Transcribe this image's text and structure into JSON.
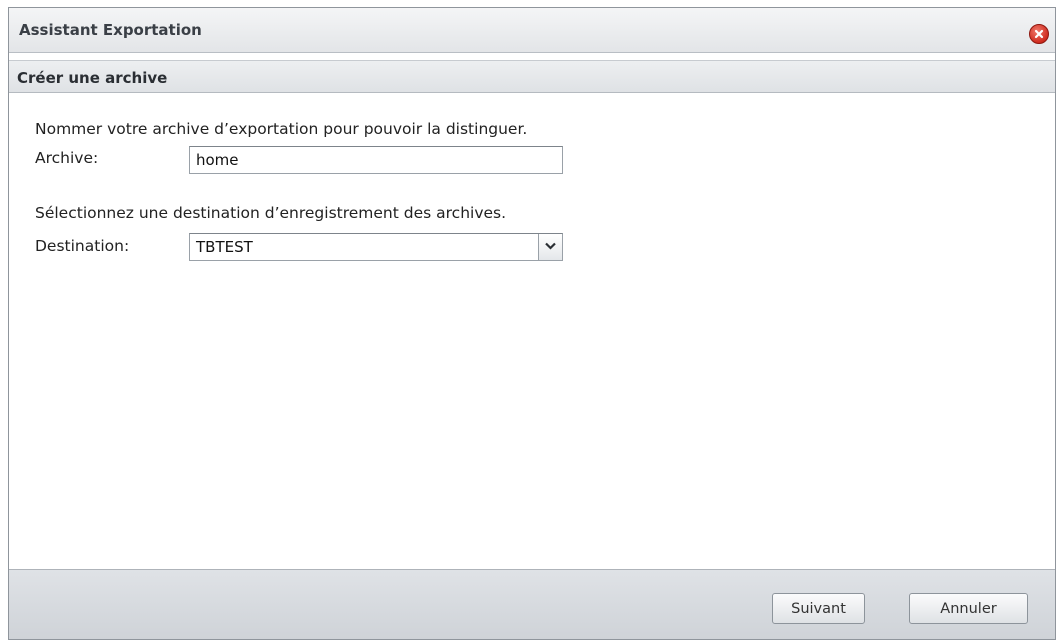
{
  "window": {
    "title": "Assistant Exportation",
    "close_icon": "close-icon"
  },
  "section": {
    "title": "Créer une archive"
  },
  "form": {
    "archive_description": "Nommer votre archive d’exportation pour pouvoir la distinguer.",
    "archive_label": "Archive:",
    "archive_value": "home",
    "destination_description": "Sélectionnez une destination d’enregistrement des archives.",
    "destination_label": "Destination:",
    "destination_value": "TBTEST",
    "destination_arrow_icon": "chevron-down-icon"
  },
  "footer": {
    "next_label": "Suivant",
    "cancel_label": "Annuler"
  },
  "colors": {
    "close_red": "#cf2b1f",
    "header_bg": "#e3e5e8",
    "footer_bg": "#d6d9dd"
  }
}
